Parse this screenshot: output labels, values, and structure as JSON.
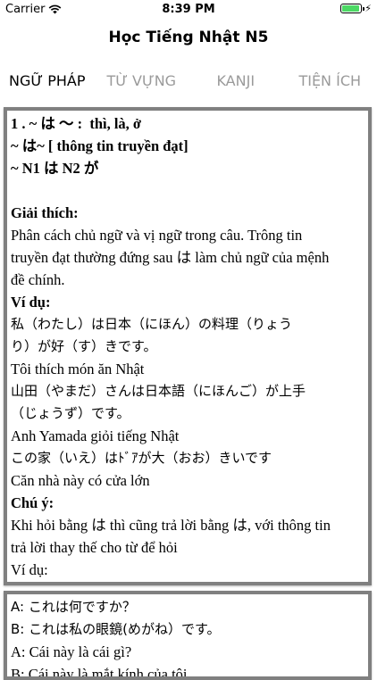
{
  "status": {
    "carrier": "Carrier",
    "time": "8:39 PM"
  },
  "nav": {
    "title": "Học Tiếng Nhật N5"
  },
  "tabs": [
    {
      "label": "NGỮ PHÁP"
    },
    {
      "label": "TỪ VỰNG"
    },
    {
      "label": "KANJI"
    },
    {
      "label": "TIỆN ÍCH"
    }
  ],
  "card1": {
    "heading1": "1 . ~ は ～ :  thì, là, ở",
    "heading2": "~ は~ [ thông tin truyền đạt]",
    "heading3": "~ N1 は N2 が",
    "explain_title": "Giải thích:",
    "explain_1": "Phân cách chủ ngữ và vị ngữ trong câu. Trông tin",
    "explain_2": "truyền đạt thường đứng sau は làm chủ ngữ của mệnh",
    "explain_3": "đề chính.",
    "example_title": "Ví dụ:",
    "ex1_jp_1": "私（わたし）は日本（にほん）の料理（りょう",
    "ex1_jp_2": "り）が好（す）きです。",
    "ex1_vi": "Tôi thích món ăn Nhật",
    "ex2_jp_1": "山田（やまだ）さんは日本語（にほんご）が上手",
    "ex2_jp_2": "（じょうず）です。",
    "ex2_vi": "Anh Yamada giỏi tiếng Nhật",
    "ex3_jp": "この家（いえ）はﾄﾞｱが大（おお）きいです",
    "ex3_vi": "Căn nhà này có cửa lớn",
    "note_title": "Chú ý:",
    "note_1": "Khi hỏi bằng は thì cũng trả lời bằng は, với thông tin",
    "note_2": "trả lời thay thế cho từ để hỏi",
    "note_example": "Ví dụ:"
  },
  "card2": {
    "line1": "A: これは何ですか？",
    "line2": "B: これは私の眼鏡(めがね）です。",
    "line3": "A: Cái này là cái gì?",
    "line4": "B: Cái này là mắt kính của tôi"
  }
}
